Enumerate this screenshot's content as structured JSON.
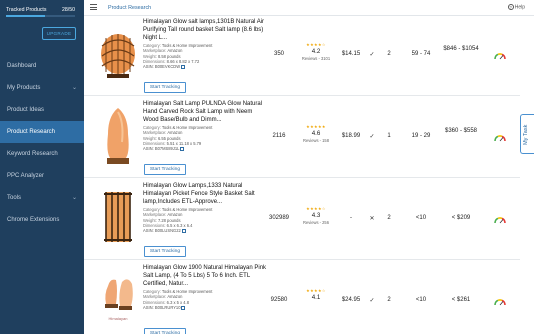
{
  "sidebar": {
    "tracked_label": "Tracked Products",
    "tracked_count": "28/50",
    "tracked_fraction": 0.56,
    "upgrade_label": "UPGRADE",
    "items": [
      {
        "label": "Dashboard",
        "chevron": false,
        "active": false
      },
      {
        "label": "My Products",
        "chevron": true,
        "active": false
      },
      {
        "label": "Product Ideas",
        "chevron": false,
        "active": false
      },
      {
        "label": "Product Research",
        "chevron": false,
        "active": true
      },
      {
        "label": "Keyword Research",
        "chevron": false,
        "active": false
      },
      {
        "label": "PPC Analyzer",
        "chevron": false,
        "active": false
      },
      {
        "label": "Tools",
        "chevron": true,
        "active": false
      },
      {
        "label": "Chrome Extensions",
        "chevron": false,
        "active": false
      }
    ]
  },
  "header": {
    "title": "Product Research",
    "help_label": "Help",
    "hamburger_icon": "hamburger-menu-icon",
    "help_icon": "question-circle-icon"
  },
  "labels": {
    "category": "Category:",
    "marketplace": "Marketplace:",
    "weight": "Weight:",
    "dimensions": "Dimensions:",
    "asin": "ASIN:",
    "start_tracking": "Start Tracking",
    "reviews_prefix": "Reviews -"
  },
  "products": [
    {
      "title": "Himalayan Glow salt lamps,1301B Natural Air Purifying Tall round basket Salt lamp (8.6 lbs) Night L...",
      "category": "Tools & Home Improvement",
      "marketplace": "Amazon",
      "weight": "8.58 pounds",
      "dimensions": "8.66 x 8.82 x 7.72",
      "asin": "B00EVKCDW",
      "rank": "350",
      "rating": "4.2",
      "stars": "★★★★☆",
      "reviews": "3101",
      "price": "$14.15",
      "fba": "✓",
      "sellers": "2",
      "sales": "59 - 74",
      "revenue": "$846 - $1054"
    },
    {
      "title": "Himalayan Salt Lamp PULNDA Glow Natural Hand Carved Rock Salt Lamp with Neem Wood Base/Bulb and Dimm...",
      "category": "Tools & Home Improvement",
      "marketplace": "Amazon",
      "weight": "6.55 pounds",
      "dimensions": "5.51 x 11.18 x 5.79",
      "asin": "B07MS89J1L",
      "rank": "2116",
      "rating": "4.6",
      "stars": "★★★★★",
      "reviews": "158",
      "price": "$18.99",
      "fba": "✓",
      "sellers": "1",
      "sales": "19 - 29",
      "revenue": "$360 - $558"
    },
    {
      "title": "Himalayan Glow Lamps,1333 Natural Himalayan Picket Fence Style Basket Salt lamp,Includes ETL-Approve...",
      "category": "Tools & Home Improvement",
      "marketplace": "Amazon",
      "weight": "7.28 pounds",
      "dimensions": "6.5 x 6.3 x 6.4",
      "asin": "B00LUSNG22",
      "rank": "302989",
      "rating": "4.3",
      "stars": "★★★★☆",
      "reviews": "256",
      "price": "-",
      "fba": "✕",
      "sellers": "2",
      "sales": "<10",
      "revenue": "< $209"
    },
    {
      "title": "Himalayan Glow 1900 Natural Himalayan Pink Salt Lamp, (4 To 5 Lbs) 5 To 6 Inch. ETL Certified, Natur...",
      "category": "Tools & Home Improvement",
      "marketplace": "Amazon",
      "weight": "",
      "dimensions": "6.3 x 5 x 4.8",
      "asin": "B00LRURY10",
      "rank": "92580",
      "rating": "4.1",
      "stars": "★★★★☆",
      "reviews": "",
      "price": "$24.95",
      "fba": "✓",
      "sellers": "2",
      "sales": "<10",
      "revenue": "< $261"
    }
  ],
  "my_task": {
    "label": "My Task"
  },
  "colors": {
    "sidebar_bg": "#1f3f5e",
    "active_item": "#2e6da4",
    "accent": "#4ba8e0",
    "star": "#f0a500"
  }
}
